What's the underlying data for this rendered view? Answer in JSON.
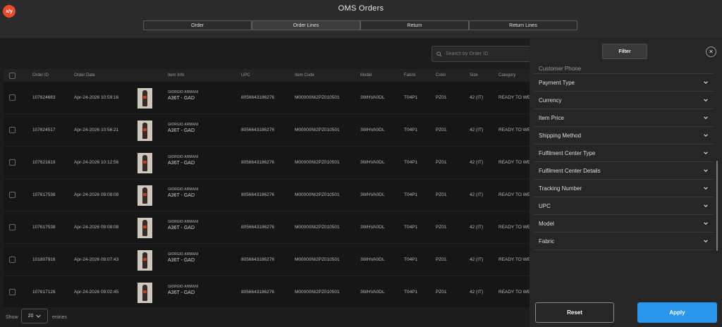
{
  "app": {
    "logo_text": "x/y",
    "title": "OMS Orders"
  },
  "tabs": [
    {
      "label": "Order",
      "active": false
    },
    {
      "label": "Order Lines",
      "active": true
    },
    {
      "label": "Return",
      "active": false
    },
    {
      "label": "Return Lines",
      "active": false
    }
  ],
  "search": {
    "placeholder": "Search by Order ID"
  },
  "table": {
    "headers": [
      "Order ID",
      "Order Date",
      "Item Info",
      "UPC",
      "Item Code",
      "Model",
      "Fabric",
      "Color",
      "Size",
      "Category"
    ],
    "rows": [
      {
        "order_id": "107624683",
        "date": "Apr-24-2026 10:59:16",
        "brand": "GIORGIO ARMANI",
        "item": "A36T - GAD",
        "upc": "8056643186276",
        "code": "M00000NI2PZ010501",
        "model": "3WHVA0DL",
        "fabric": "T04P1",
        "color": "PZ01",
        "size": "42 (IT)",
        "category": "READY TO WE"
      },
      {
        "order_id": "107624517",
        "date": "Apr-24-2026 10:56:21",
        "brand": "GIORGIO ARMANI",
        "item": "A36T - GAD",
        "upc": "8056643186276",
        "code": "M00000NI2PZ010501",
        "model": "3WHVA0DL",
        "fabric": "T04P1",
        "color": "PZ01",
        "size": "42 (IT)",
        "category": "READY TO WE"
      },
      {
        "order_id": "107621619",
        "date": "Apr-24-2026 10:12:56",
        "brand": "GIORGIO ARMANI",
        "item": "A36T - GAD",
        "upc": "8056643186276",
        "code": "M00000NI2PZ010501",
        "model": "3WHVA0DL",
        "fabric": "T04P1",
        "color": "PZ01",
        "size": "42 (IT)",
        "category": "READY TO WE"
      },
      {
        "order_id": "107617538",
        "date": "Apr-24-2026 09:08:08",
        "brand": "GIORGIO ARMANI",
        "item": "A36T - GAD",
        "upc": "8056643186276",
        "code": "M00000NI2PZ010501",
        "model": "3WHVA0DL",
        "fabric": "T04P1",
        "color": "PZ01",
        "size": "42 (IT)",
        "category": "READY TO WE"
      },
      {
        "order_id": "107617538",
        "date": "Apr-24-2026 09:08:08",
        "brand": "GIORGIO ARMANI",
        "item": "A36T - GAD",
        "upc": "8056643186276",
        "code": "M00000NI2PZ010501",
        "model": "3WHVA0DL",
        "fabric": "T04P1",
        "color": "PZ01",
        "size": "42 (IT)",
        "category": "READY TO WE"
      },
      {
        "order_id": "101807916",
        "date": "Apr-24-2026 09:07:43",
        "brand": "GIORGIO ARMANI",
        "item": "A36T - GAD",
        "upc": "8056643186276",
        "code": "M00000NI2PZ010501",
        "model": "3WHVA0DL",
        "fabric": "T04P1",
        "color": "PZ01",
        "size": "42 (IT)",
        "category": "READY TO WE"
      },
      {
        "order_id": "107617126",
        "date": "Apr-24-2026 09:02:45",
        "brand": "GIORGIO ARMANI",
        "item": "A36T - GAD",
        "upc": "8056643186276",
        "code": "M00000NI2PZ010501",
        "model": "3WHVA0DL",
        "fabric": "T04P1",
        "color": "PZ01",
        "size": "42 (IT)",
        "category": "READY TO WE"
      }
    ]
  },
  "footer": {
    "show_label": "Show",
    "page_size": "20",
    "entries_label": "entries"
  },
  "filter_panel": {
    "title": "Filter",
    "partial_item": "Customer Phone",
    "items": [
      "Payment Type",
      "Currency",
      "Item Price",
      "Shipping Method",
      "Fulfilment Center Type",
      "Fulfilment Center Details",
      "Tracking Number",
      "UPC",
      "Model",
      "Fabric"
    ],
    "reset_label": "Reset",
    "apply_label": "Apply"
  },
  "colors": {
    "accent": "#2b95e9",
    "logo": "#e64a2e"
  }
}
